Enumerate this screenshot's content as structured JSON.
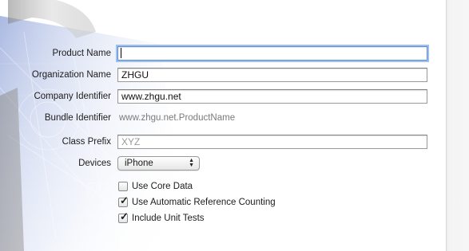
{
  "form": {
    "product_name": {
      "label": "Product Name",
      "value": ""
    },
    "organization_name": {
      "label": "Organization Name",
      "value": "ZHGU"
    },
    "company_identifier": {
      "label": "Company Identifier",
      "value": "www.zhgu.net"
    },
    "bundle_identifier": {
      "label": "Bundle Identifier",
      "value": "www.zhgu.net.ProductName"
    },
    "class_prefix": {
      "label": "Class Prefix",
      "value": "",
      "placeholder": "XYZ"
    },
    "devices": {
      "label": "Devices",
      "selected": "iPhone"
    },
    "options": [
      {
        "label": "Use Core Data",
        "checked": false
      },
      {
        "label": "Use Automatic Reference Counting",
        "checked": true
      },
      {
        "label": "Include Unit Tests",
        "checked": true
      }
    ]
  },
  "icons": {
    "background": "xcode-hammer-blueprint-icon",
    "popup_arrows": "up-down-arrows-icon",
    "checkmark": "checkmark-icon"
  },
  "colors": {
    "focus_ring": "#9ec0ee",
    "blueprint": "#8fa4dc"
  }
}
